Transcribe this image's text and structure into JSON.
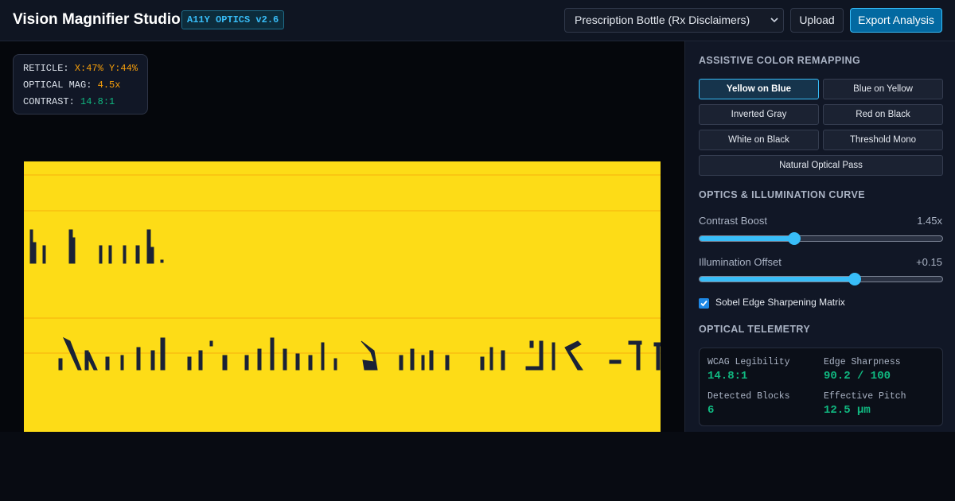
{
  "header": {
    "title": "Vision Magnifier Studio",
    "version_badge": "A11Y OPTICS v2.6",
    "document_select": {
      "selected": "Prescription Bottle (Rx Disclaimers)"
    },
    "upload_label": "Upload",
    "export_label": "Export Analysis"
  },
  "hud": {
    "reticle_label": "RETICLE:",
    "reticle_value": "X:47% Y:44%",
    "mag_label": "OPTICAL MAG:",
    "mag_value": "4.5x",
    "contrast_label": "CONTRAST:",
    "contrast_value": "14.8:1"
  },
  "canvas": {
    "background_color": "#fddc17",
    "ink_color": "#1a2236",
    "guide_line_color": "#f59e0b"
  },
  "sidebar": {
    "remap_title": "ASSISTIVE COLOR REMAPPING",
    "palettes": [
      {
        "label": "Yellow on Blue",
        "active": true
      },
      {
        "label": "Blue on Yellow",
        "active": false
      },
      {
        "label": "Inverted Gray",
        "active": false
      },
      {
        "label": "Red on Black",
        "active": false
      },
      {
        "label": "White on Black",
        "active": false
      },
      {
        "label": "Threshold Mono",
        "active": false
      },
      {
        "label": "Natural Optical Pass",
        "active": false
      }
    ],
    "optics_title": "OPTICS & ILLUMINATION CURVE",
    "sliders": [
      {
        "label": "Contrast Boost",
        "display": "1.45x",
        "fraction": 0.39
      },
      {
        "label": "Illumination Offset",
        "display": "+0.15",
        "fraction": 0.64
      }
    ],
    "sobel": {
      "label": "Sobel Edge Sharpening Matrix",
      "checked": true
    },
    "telemetry_title": "OPTICAL TELEMETRY",
    "telemetry": [
      {
        "label": "WCAG Legibility",
        "value": "14.8:1"
      },
      {
        "label": "Edge Sharpness",
        "value": "90.2 / 100"
      },
      {
        "label": "Detected Blocks",
        "value": "6"
      },
      {
        "label": "Effective Pitch",
        "value": "12.5 µm"
      }
    ]
  },
  "colors": {
    "accent": "#38bdf8",
    "primary_button": "#0369a1",
    "hud_value_warm": "#f59e0b",
    "metric_green": "#10b981"
  },
  "icons": [
    "chevron-down-icon",
    "checkmark-icon"
  ]
}
